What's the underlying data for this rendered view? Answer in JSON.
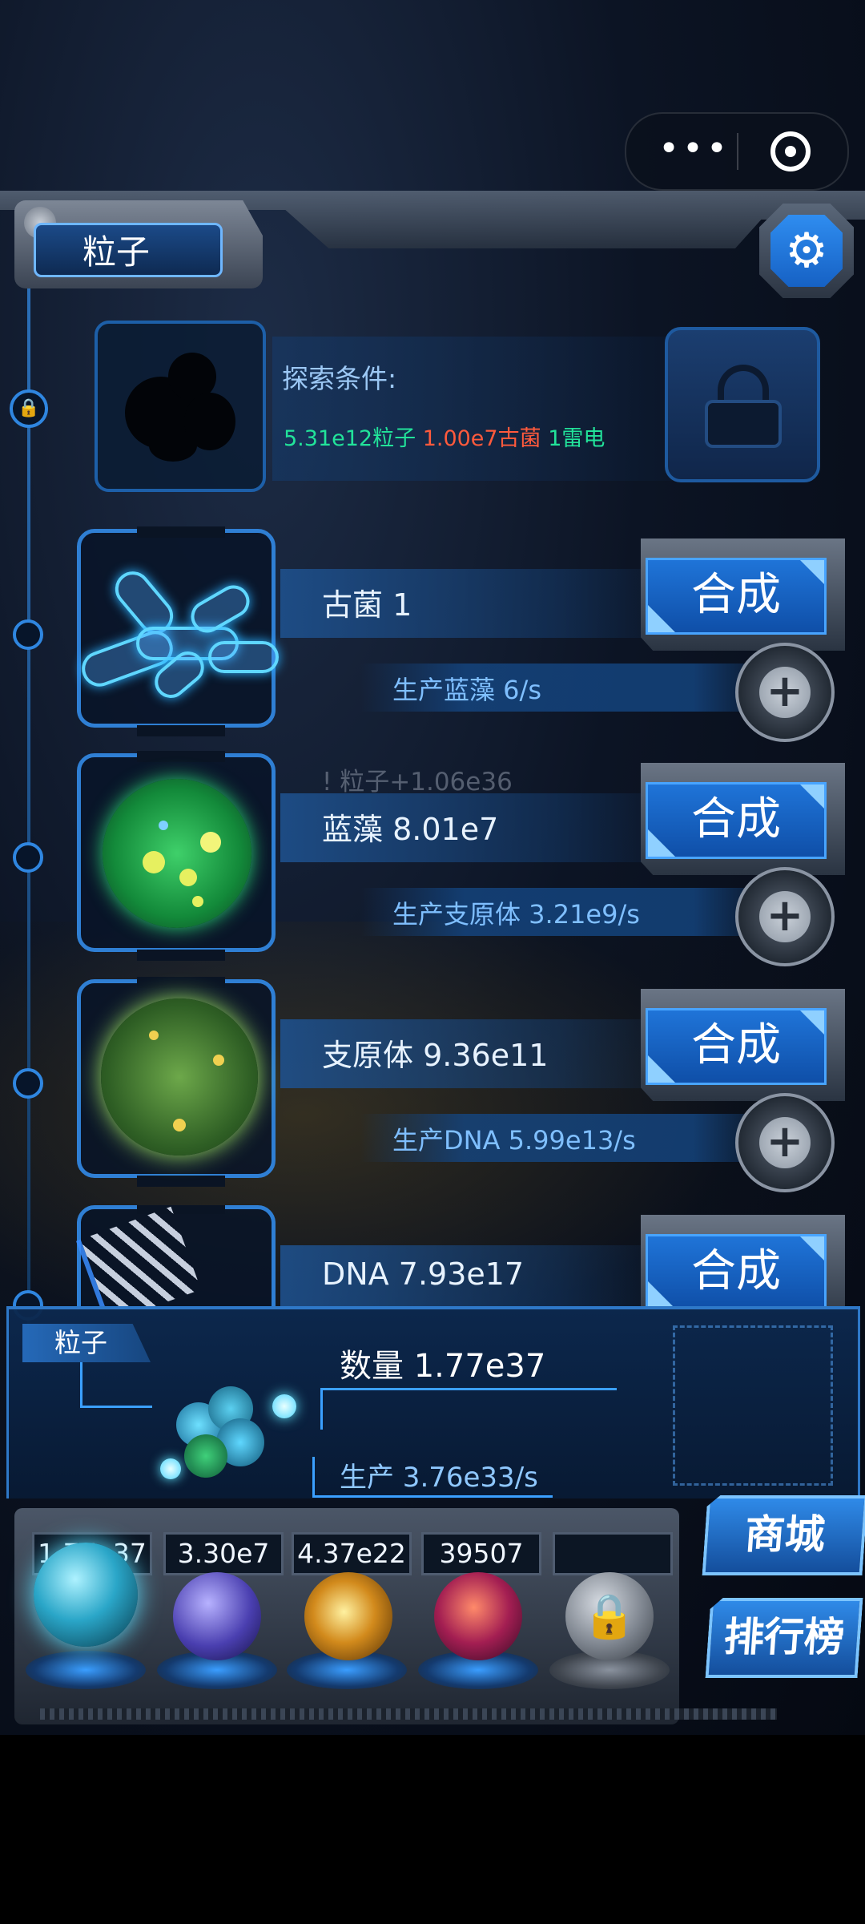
{
  "header": {
    "tab_label": "粒子",
    "more_icon": "more-dots-icon",
    "close_icon": "target-icon",
    "settings_icon": "gear-icon"
  },
  "explore": {
    "title": "探索条件:",
    "conditions": [
      {
        "text": "5.31e12粒子",
        "color": "#22e39a"
      },
      {
        "text": "1.00e7古菌",
        "color": "#ff5a3c"
      },
      {
        "text": "1雷电",
        "color": "#22e39a"
      }
    ]
  },
  "organisms": [
    {
      "name": "古菌 1",
      "production": "生产蓝藻 6/s",
      "synth_label": "合成"
    },
    {
      "name": "蓝藻 8.01e7",
      "production": "生产支原体 3.21e9/s",
      "synth_label": "合成"
    },
    {
      "name": "支原体 9.36e11",
      "production": "生产DNA 5.99e13/s",
      "synth_label": "合成"
    },
    {
      "name": "DNA 7.93e17",
      "synth_label": "合成"
    }
  ],
  "toast": "! 粒子+1.06e36",
  "info": {
    "tag": "粒子",
    "quantity": "数量 1.77e37",
    "production": "生产 3.76e33/s"
  },
  "resources": [
    {
      "value": "1.77e37",
      "icon": "particle-orb-icon"
    },
    {
      "value": "3.30e7",
      "icon": "lightning-orb-icon"
    },
    {
      "value": "4.37e22",
      "icon": "galaxy-orb-icon"
    },
    {
      "value": "39507",
      "icon": "brain-orb-icon"
    },
    {
      "value": "",
      "icon": "lock-orb-icon"
    }
  ],
  "side_buttons": {
    "shop": "商城",
    "leaderboard": "排行榜"
  },
  "colors": {
    "accent_blue": "#1f74d8",
    "condition_ok": "#22e39a",
    "condition_missing": "#ff5a3c"
  }
}
